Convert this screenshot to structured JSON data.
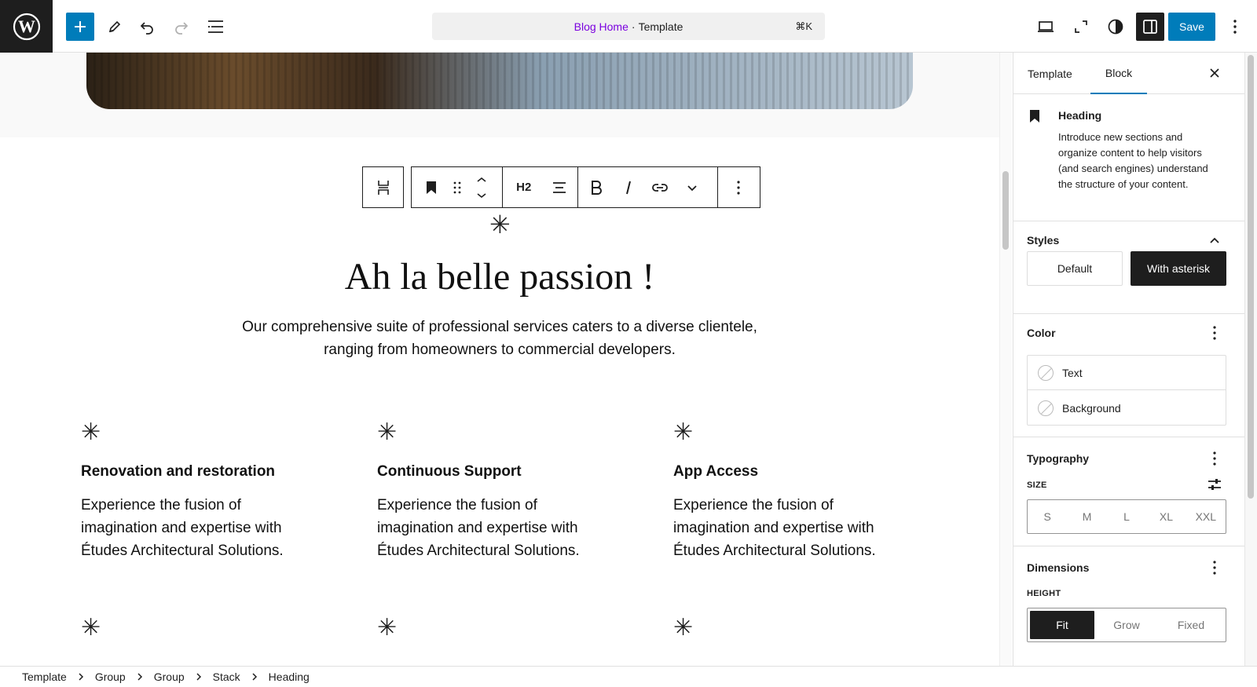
{
  "topbar": {
    "command_bar": {
      "link": "Blog Home",
      "separator": "·",
      "context": "Template",
      "shortcut": "⌘K"
    },
    "save_label": "Save"
  },
  "block_toolbar": {
    "heading_level": "H2"
  },
  "canvas": {
    "hero_title": "Ah la belle passion !",
    "hero_description": "Our comprehensive suite of professional services caters to a diverse clientele, ranging from homeowners to commercial developers.",
    "asterisk": "✳",
    "features": [
      {
        "title": "Renovation and restoration",
        "description": "Experience the fusion of imagination and expertise with Études Architectural Solutions."
      },
      {
        "title": "Continuous Support",
        "description": "Experience the fusion of imagination and expertise with Études Architectural Solutions."
      },
      {
        "title": "App Access",
        "description": "Experience the fusion of imagination and expertise with Études Architectural Solutions."
      }
    ]
  },
  "sidebar": {
    "tabs": [
      {
        "label": "Template",
        "active": false
      },
      {
        "label": "Block",
        "active": true
      }
    ],
    "block_card": {
      "title": "Heading",
      "description": "Introduce new sections and organize content to help visitors (and search engines) understand the structure of your content."
    },
    "styles": {
      "title": "Styles",
      "options": [
        "Default",
        "With asterisk"
      ],
      "selected": "With asterisk"
    },
    "color": {
      "title": "Color",
      "items": [
        "Text",
        "Background"
      ]
    },
    "typography": {
      "title": "Typography",
      "size_label": "SIZE",
      "sizes": [
        "S",
        "M",
        "L",
        "XL",
        "XXL"
      ]
    },
    "dimensions": {
      "title": "Dimensions",
      "height_label": "HEIGHT",
      "options": [
        "Fit",
        "Grow",
        "Fixed"
      ],
      "selected": "Fit"
    }
  },
  "breadcrumb": [
    "Template",
    "Group",
    "Group",
    "Stack",
    "Heading"
  ],
  "colors": {
    "accent": "#007cba",
    "dark": "#1e1e1e",
    "link": "#7a00df"
  }
}
